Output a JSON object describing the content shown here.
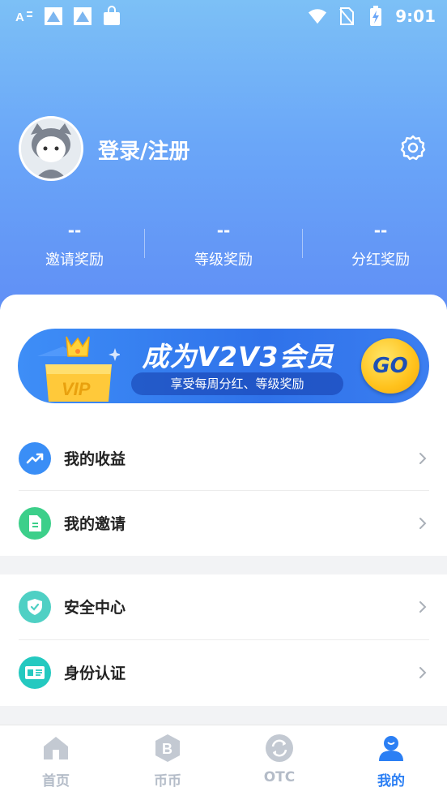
{
  "status_bar": {
    "time": "9:01",
    "left_icons": [
      "font-icon",
      "image-icon",
      "image-icon",
      "bag-icon"
    ],
    "right_icons": [
      "wifi-icon",
      "no-sim-icon",
      "battery-charging-icon"
    ]
  },
  "profile": {
    "login_label": "登录/注册"
  },
  "stats": [
    {
      "value": "--",
      "label": "邀请奖励"
    },
    {
      "value": "--",
      "label": "等级奖励"
    },
    {
      "value": "--",
      "label": "分红奖励"
    }
  ],
  "banner": {
    "title": "成为V2V3会员",
    "subtitle": "享受每周分红、等级奖励",
    "vip_text": "VIP",
    "go_label": "GO"
  },
  "menu_group1": [
    {
      "label": "我的收益",
      "icon": "trending-up-icon",
      "color": "#3a8ef6"
    },
    {
      "label": "我的邀请",
      "icon": "document-icon",
      "color": "#3ccf8a"
    }
  ],
  "menu_group2": [
    {
      "label": "安全中心",
      "icon": "shield-check-icon",
      "color": "#4fd0c4"
    },
    {
      "label": "身份认证",
      "icon": "id-card-icon",
      "color": "#24c9c0"
    }
  ],
  "bottom_nav": [
    {
      "label": "首页",
      "icon": "home-icon",
      "active": false
    },
    {
      "label": "币币",
      "icon": "bitcoin-icon",
      "active": false
    },
    {
      "label": "OTC",
      "icon": "exchange-icon",
      "active": false
    },
    {
      "label": "我的",
      "icon": "user-icon",
      "active": true
    }
  ],
  "colors": {
    "accent": "#2b7ff4",
    "header_top": "#7cc0f6",
    "header_bottom": "#5f8df5",
    "inactive_nav": "#b4bcc8"
  }
}
